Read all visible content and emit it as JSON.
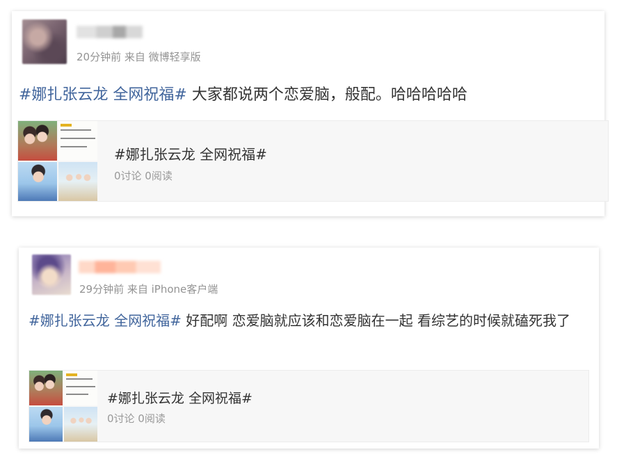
{
  "posts": [
    {
      "meta": "20分钟前 来自 微博轻享版",
      "hashtag": "#娜扎张云龙 全网祝福#",
      "body": " 大家都说两个恋爱脑，般配。哈哈哈哈哈",
      "topic": {
        "title": "#娜扎张云龙 全网祝福#",
        "stats": "0讨论 0阅读"
      }
    },
    {
      "meta": "29分钟前 来自 iPhone客户端",
      "hashtag": "#娜扎张云龙 全网祝福#",
      "body": " 好配啊 恋爱脑就应该和恋爱脑在一起 看综艺的时候就磕死我了",
      "topic": {
        "title": "#娜扎张云龙 全网祝福#",
        "stats": "0讨论 0阅读"
      }
    }
  ],
  "colors": {
    "link": "#41659c",
    "meta": "#939393",
    "text": "#333333"
  }
}
